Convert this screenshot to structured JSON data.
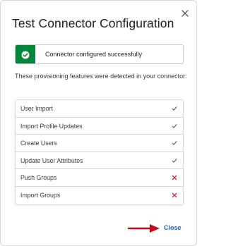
{
  "dialog": {
    "title": "Test Connector Configuration",
    "close_icon": "close-icon"
  },
  "banner": {
    "icon": "check-circle-icon",
    "text": "Connector configured successfully",
    "color": "#00873c"
  },
  "description": "These provisioning features were detected in your connector:",
  "features": [
    {
      "label": "User Import",
      "status": "supported"
    },
    {
      "label": "Import Profile Updates",
      "status": "supported"
    },
    {
      "label": "Create Users",
      "status": "supported"
    },
    {
      "label": "Update User Attributes",
      "status": "supported"
    },
    {
      "label": "Push Groups",
      "status": "unsupported"
    },
    {
      "label": "Import Groups",
      "status": "unsupported"
    }
  ],
  "status_colors": {
    "supported": "#555b60",
    "unsupported": "#d1232a"
  },
  "footer": {
    "close_label": "Close",
    "close_color": "#1662dd",
    "annotation_arrow_color": "#c00d1e"
  }
}
